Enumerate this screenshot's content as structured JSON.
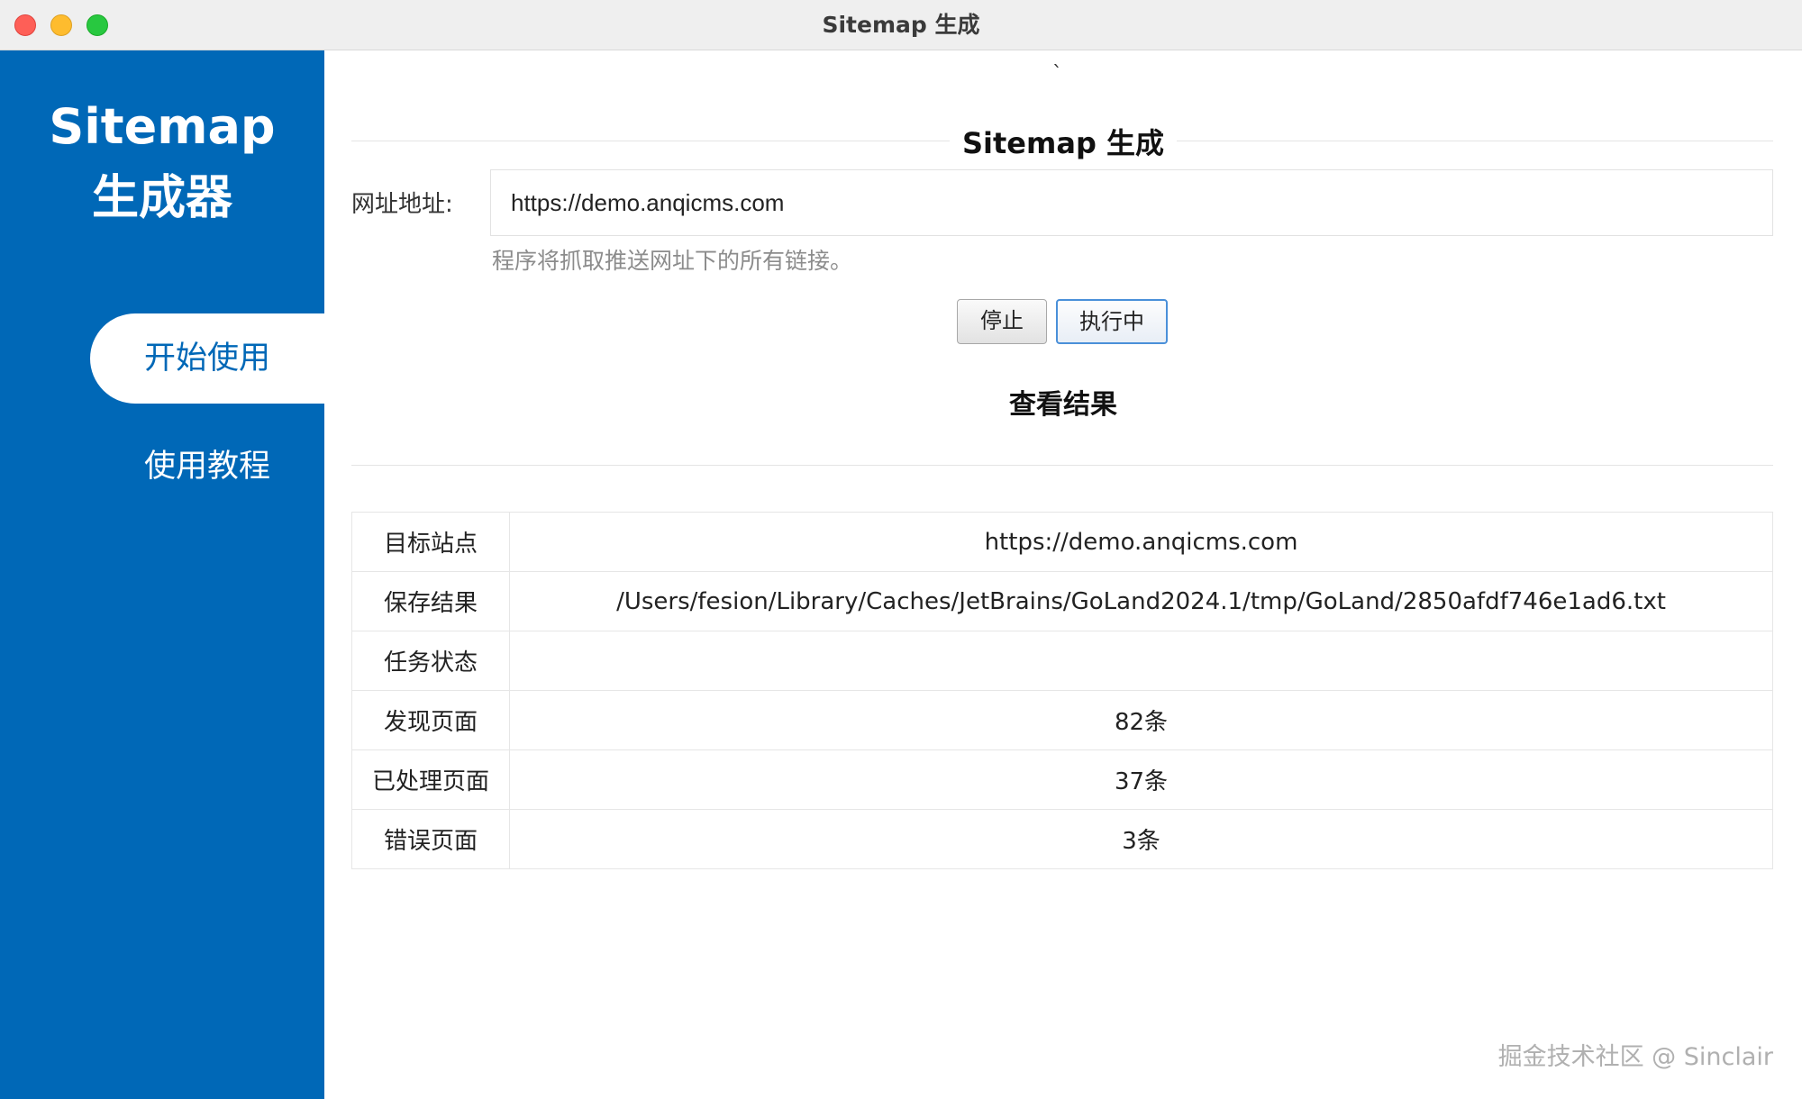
{
  "window": {
    "title": "Sitemap 生成"
  },
  "sidebar": {
    "logo_line1": "Sitemap",
    "logo_line2": "生成器",
    "items": [
      {
        "label": "开始使用"
      },
      {
        "label": "使用教程"
      }
    ]
  },
  "main": {
    "stray_mark": "`",
    "title": "Sitemap 生成",
    "url_label": "网址地址:",
    "url_value": "https://demo.anqicms.com",
    "hint": "程序将抓取推送网址下的所有链接。",
    "stop_button": "停止",
    "running_button": "执行中",
    "results_title": "查看结果",
    "results": [
      {
        "key": "目标站点",
        "value": "https://demo.anqicms.com"
      },
      {
        "key": "保存结果",
        "value": "/Users/fesion/Library/Caches/JetBrains/GoLand2024.1/tmp/GoLand/2850afdf746e1ad6.txt"
      },
      {
        "key": "任务状态",
        "value": ""
      },
      {
        "key": "发现页面",
        "value": "82条"
      },
      {
        "key": "已处理页面",
        "value": "37条"
      },
      {
        "key": "错误页面",
        "value": "3条"
      }
    ]
  },
  "watermark": "掘金技术社区 @ Sinclair"
}
